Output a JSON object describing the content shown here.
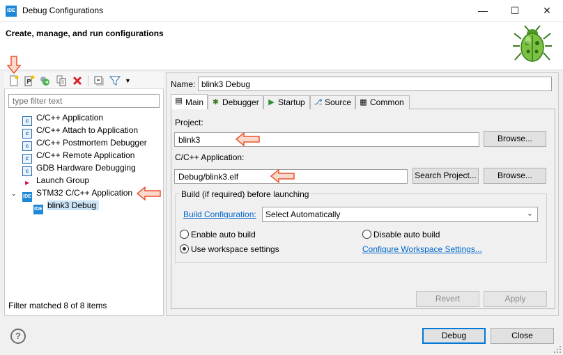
{
  "window": {
    "app_icon_text": "IDE",
    "title": "Debug Configurations",
    "minimize": "—",
    "maximize": "☐",
    "close": "✕"
  },
  "header": {
    "title": "Create, manage, and run configurations",
    "icon": "bug-icon"
  },
  "toolbar": {
    "icons": [
      "new-configuration-icon",
      "new-prototype-icon",
      "export-icon",
      "duplicate-icon",
      "delete-icon",
      "collapse-all-icon",
      "filter-icon",
      "view-menu-icon"
    ]
  },
  "filter": {
    "placeholder": "type filter text",
    "status": "Filter matched 8 of 8 items"
  },
  "tree": {
    "items": [
      {
        "label": "C/C++ Application",
        "icon": "c-icon"
      },
      {
        "label": "C/C++ Attach to Application",
        "icon": "c-icon"
      },
      {
        "label": "C/C++ Postmortem Debugger",
        "icon": "c-icon"
      },
      {
        "label": "C/C++ Remote Application",
        "icon": "c-icon"
      },
      {
        "label": "GDB Hardware Debugging",
        "icon": "c-icon"
      },
      {
        "label": "Launch Group",
        "icon": "launch-group-icon"
      },
      {
        "label": "STM32 C/C++ Application",
        "icon": "ide-icon",
        "expanded": true
      },
      {
        "label": "blink3 Debug",
        "icon": "ide-icon",
        "selected": true
      }
    ]
  },
  "name": {
    "label": "Name:",
    "value": "blink3 Debug"
  },
  "tabs": [
    {
      "label": "Main",
      "icon": "main-icon",
      "active": true
    },
    {
      "label": "Debugger",
      "icon": "debugger-icon"
    },
    {
      "label": "Startup",
      "icon": "startup-icon"
    },
    {
      "label": "Source",
      "icon": "source-icon"
    },
    {
      "label": "Common",
      "icon": "common-icon"
    }
  ],
  "main": {
    "project_label": "Project:",
    "project_value": "blink3",
    "browse_label": "Browse...",
    "app_label": "C/C++ Application:",
    "app_value": "Debug/blink3.elf",
    "search_project_label": "Search Project...",
    "browse2_label": "Browse...",
    "build_group_title": "Build (if required) before launching",
    "build_config_link": "Build Configuration:",
    "build_config_value": "Select Automatically",
    "enable_auto_build": "Enable auto build",
    "disable_auto_build": "Disable auto build",
    "use_workspace_settings": "Use workspace settings",
    "configure_workspace_link": "Configure Workspace Settings...",
    "selected_radio": "use_workspace_settings"
  },
  "actions": {
    "revert": "Revert",
    "apply": "Apply",
    "debug": "Debug",
    "close": "Close",
    "help": "?"
  },
  "colors": {
    "accent": "#0078d7",
    "annotation_arrow": "#e8542c",
    "link": "#0066cc",
    "selection": "#cce4f7"
  }
}
